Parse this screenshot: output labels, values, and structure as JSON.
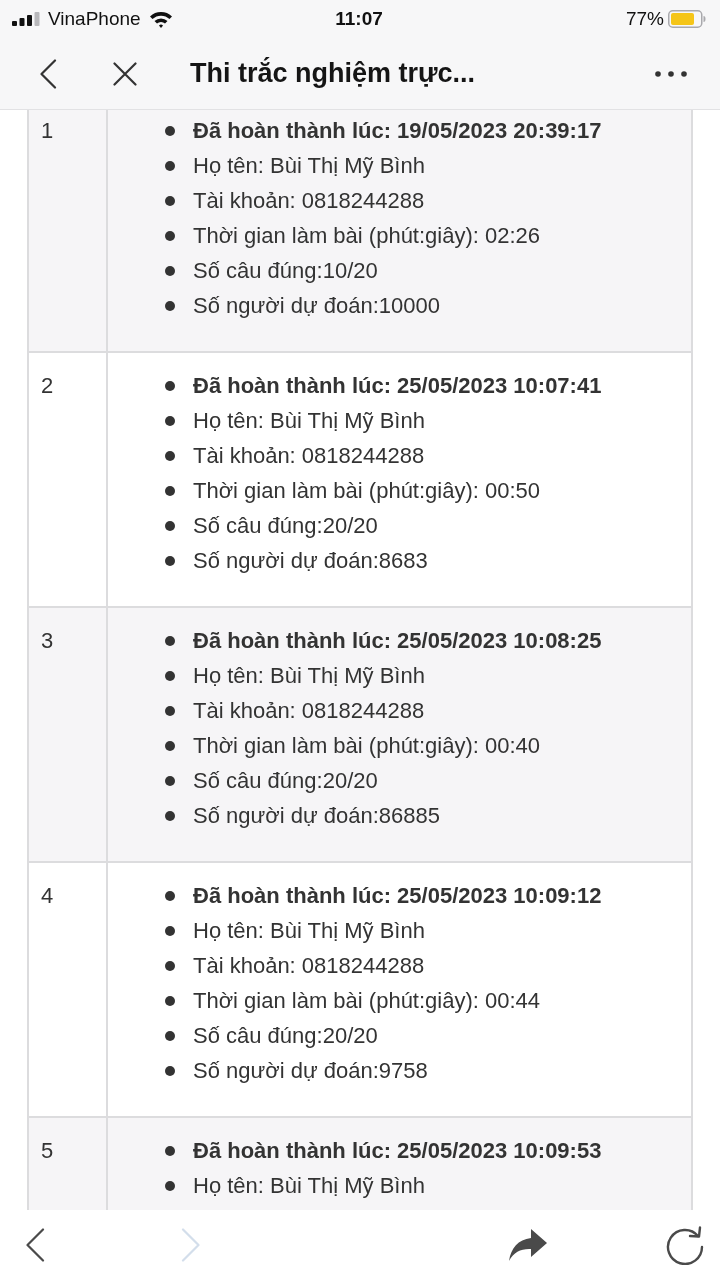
{
  "status_bar": {
    "carrier": "VinaPhone",
    "time": "11:07",
    "battery": "77%"
  },
  "nav_bar": {
    "title": "Thi trắc nghiệm trực..."
  },
  "results": [
    {
      "number": "1",
      "completed": "Đã hoàn thành lúc: 19/05/2023 20:39:17",
      "details": [
        "Họ tên: Bùi Thị Mỹ Bình",
        "Tài khoản: 0818244288",
        "Thời gian làm bài (phút:giây): 02:26",
        "Số câu đúng:10/20",
        "Số người dự đoán:10000"
      ]
    },
    {
      "number": "2",
      "completed": "Đã hoàn thành lúc: 25/05/2023 10:07:41",
      "details": [
        "Họ tên: Bùi Thị Mỹ Bình",
        "Tài khoản: 0818244288",
        "Thời gian làm bài (phút:giây): 00:50",
        "Số câu đúng:20/20",
        "Số người dự đoán:8683"
      ]
    },
    {
      "number": "3",
      "completed": "Đã hoàn thành lúc: 25/05/2023 10:08:25",
      "details": [
        "Họ tên: Bùi Thị Mỹ Bình",
        "Tài khoản: 0818244288",
        "Thời gian làm bài (phút:giây): 00:40",
        "Số câu đúng:20/20",
        "Số người dự đoán:86885"
      ]
    },
    {
      "number": "4",
      "completed": "Đã hoàn thành lúc: 25/05/2023 10:09:12",
      "details": [
        "Họ tên: Bùi Thị Mỹ Bình",
        "Tài khoản: 0818244288",
        "Thời gian làm bài (phút:giây): 00:44",
        "Số câu đúng:20/20",
        "Số người dự đoán:9758"
      ]
    },
    {
      "number": "5",
      "completed": "Đã hoàn thành lúc: 25/05/2023 10:09:53",
      "details": [
        "Họ tên: Bùi Thị Mỹ Bình"
      ]
    }
  ],
  "toolbar": {
    "buttons": [
      {
        "kind": "back",
        "disabled": false
      },
      {
        "kind": "forward",
        "disabled": true
      },
      {
        "kind": "share",
        "disabled": false
      },
      {
        "kind": "reload",
        "disabled": false
      }
    ]
  }
}
